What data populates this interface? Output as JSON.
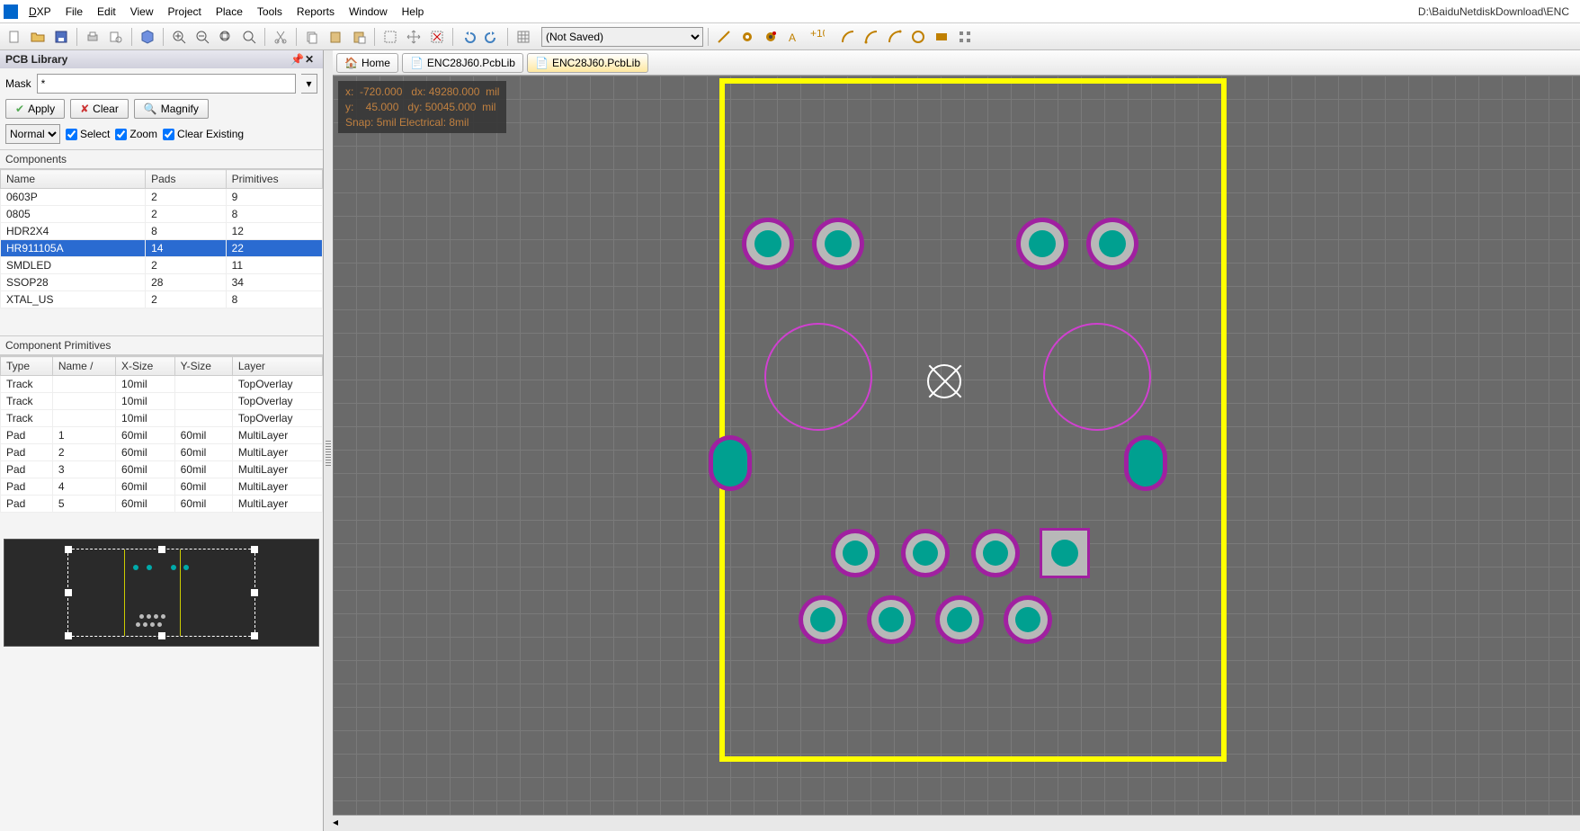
{
  "title_path": "D:\\BaiduNetdiskDownload\\ENC",
  "menu": {
    "dxp": "DXP",
    "file": "File",
    "edit": "Edit",
    "view": "View",
    "project": "Project",
    "place": "Place",
    "tools": "Tools",
    "reports": "Reports",
    "window": "Window",
    "help": "Help"
  },
  "toolbar": {
    "notsaved": "(Not Saved)"
  },
  "tabs": {
    "home": "Home",
    "t1": "ENC28J60.PcbLib",
    "t2": "ENC28J60.PcbLib"
  },
  "hud": {
    "x": "x:  -720.000",
    "dx": "dx: 49280.000  mil",
    "y": "y:    45.000",
    "dy": "dy: 50045.000  mil",
    "snap": "Snap: 5mil Electrical: 8mil"
  },
  "panel": {
    "title": "PCB Library",
    "mask": "Mask",
    "maskval": "*",
    "apply": "Apply",
    "clear": "Clear",
    "magnify": "Magnify",
    "normal": "Normal",
    "select": "Select",
    "zoom": "Zoom",
    "clearex": "Clear Existing"
  },
  "comp": {
    "header": "Components",
    "cols": [
      "Name",
      "Pads",
      "Primitives"
    ],
    "rows": [
      {
        "n": "0603P",
        "p": "2",
        "pr": "9"
      },
      {
        "n": "0805",
        "p": "2",
        "pr": "8"
      },
      {
        "n": "HDR2X4",
        "p": "8",
        "pr": "12"
      },
      {
        "n": "HR911105A",
        "p": "14",
        "pr": "22"
      },
      {
        "n": "SMDLED",
        "p": "2",
        "pr": "11"
      },
      {
        "n": "SSOP28",
        "p": "28",
        "pr": "34"
      },
      {
        "n": "XTAL_US",
        "p": "2",
        "pr": "8"
      }
    ]
  },
  "prim": {
    "header": "Component Primitives",
    "cols": [
      "Type",
      "Name /",
      "X-Size",
      "Y-Size",
      "Layer"
    ],
    "rows": [
      {
        "t": "Track",
        "n": "",
        "x": "10mil",
        "y": "",
        "l": "TopOverlay"
      },
      {
        "t": "Track",
        "n": "",
        "x": "10mil",
        "y": "",
        "l": "TopOverlay"
      },
      {
        "t": "Track",
        "n": "",
        "x": "10mil",
        "y": "",
        "l": "TopOverlay"
      },
      {
        "t": "Pad",
        "n": "1",
        "x": "60mil",
        "y": "60mil",
        "l": "MultiLayer"
      },
      {
        "t": "Pad",
        "n": "2",
        "x": "60mil",
        "y": "60mil",
        "l": "MultiLayer"
      },
      {
        "t": "Pad",
        "n": "3",
        "x": "60mil",
        "y": "60mil",
        "l": "MultiLayer"
      },
      {
        "t": "Pad",
        "n": "4",
        "x": "60mil",
        "y": "60mil",
        "l": "MultiLayer"
      },
      {
        "t": "Pad",
        "n": "5",
        "x": "60mil",
        "y": "60mil",
        "l": "MultiLayer"
      }
    ]
  }
}
